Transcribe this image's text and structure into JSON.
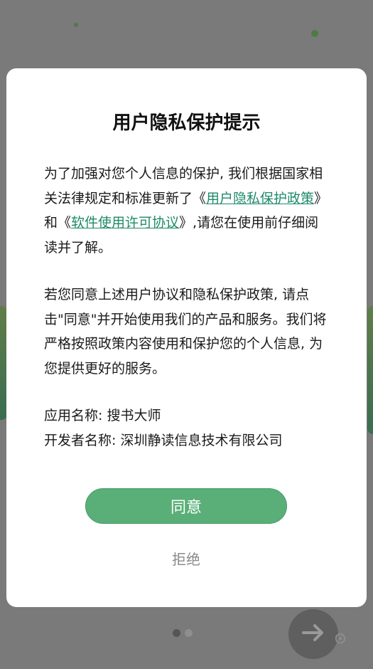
{
  "dialog": {
    "title": "用户隐私保护提示",
    "p1": {
      "t1": "为了加强对您个人信息的保护, 我们根据国家相关法律规定和标准更新了《",
      "link1": "用户隐私保护政策",
      "t2": "》 和《",
      "link2": "软件使用许可协议",
      "t3": "》,请您在使用前仔细阅读并了解。"
    },
    "p2": "若您同意上述用户协议和隐私保护政策, 请点击\"同意\"并开始使用我们的产品和服务。我们将严格按照政策内容使用和保护您的个人信息, 为您提供更好的服务。",
    "app_name_line": "应用名称: 搜书大师",
    "developer_line": "开发者名称: 深圳静读信息技术有限公司",
    "agree_label": "同意",
    "reject_label": "拒绝"
  },
  "pager": {
    "total": 2,
    "active": 1
  },
  "icons": {
    "next": "arrow-right-icon"
  },
  "colors": {
    "accent": "#5aaf78",
    "link": "#1f8a6a",
    "overlay": "#7a7a7a"
  }
}
